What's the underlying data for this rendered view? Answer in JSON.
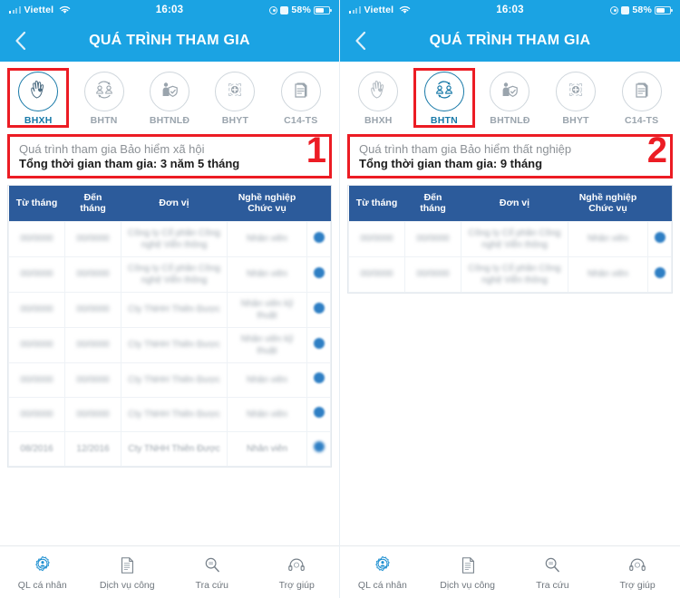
{
  "statusbar": {
    "carrier": "Viettel",
    "time": "16:03",
    "battery_pct": "58%",
    "wifi_icon": "wifi-icon",
    "location_icon": "location-icon",
    "alarm_icon": "alarm-icon",
    "battery_icon": "battery-icon",
    "signal_icon": "signal-bars-icon"
  },
  "header": {
    "title": "QUÁ TRÌNH THAM GIA",
    "back_icon": "chevron-left-icon",
    "bg_color": "#1ba3e3"
  },
  "tabs": [
    {
      "id": "bhxh",
      "label": "BHXH",
      "icon": "praying-hands-heart-icon"
    },
    {
      "id": "bhtn",
      "label": "BHTN",
      "icon": "people-exchange-icon"
    },
    {
      "id": "bhtnld",
      "label": "BHTNLĐ",
      "icon": "worker-shield-icon"
    },
    {
      "id": "bhyt",
      "label": "BHYT",
      "icon": "medical-cross-icon"
    },
    {
      "id": "c14ts",
      "label": "C14-TS",
      "icon": "document-list-icon"
    }
  ],
  "table": {
    "columns": [
      "Từ tháng",
      "Đến tháng",
      "Đơn vị",
      "Nghề nghiệp\nChức vụ",
      ""
    ],
    "col_from": "Từ tháng",
    "col_to_l1": "Đến",
    "col_to_l2": "tháng",
    "col_unit": "Đơn vị",
    "col_job_l1": "Nghề nghiệp",
    "col_job_l2": "Chức vụ",
    "header_bg": "#2c5b9b",
    "eye_icon": "eye-icon"
  },
  "panels": [
    {
      "step": "1",
      "active_tab": "bhxh",
      "info_title": "Quá trình tham gia Bảo hiểm xã hội",
      "info_total": "Tổng thời gian tham gia: 3 năm 5 tháng",
      "highlight_color": "#ec1c24",
      "rows": [
        {
          "from": "00/0000",
          "to": "00/0000",
          "unit": "Công ty Cổ phần Công nghệ Viễn thông",
          "job": "Nhân viên"
        },
        {
          "from": "00/0000",
          "to": "00/0000",
          "unit": "Công ty Cổ phần Công nghệ Viễn thông",
          "job": "Nhân viên"
        },
        {
          "from": "00/0000",
          "to": "00/0000",
          "unit": "Cty TNHH Thiên Được",
          "job": "Nhân viên kỹ thuật"
        },
        {
          "from": "00/0000",
          "to": "00/0000",
          "unit": "Cty TNHH Thiên Được",
          "job": "Nhân viên kỹ thuật"
        },
        {
          "from": "00/0000",
          "to": "00/0000",
          "unit": "Cty TNHH Thiên Được",
          "job": "Nhân viên"
        },
        {
          "from": "00/0000",
          "to": "00/0000",
          "unit": "Cty TNHH Thiên Được",
          "job": "Nhân viên"
        },
        {
          "from": "08/2016",
          "to": "12/2016",
          "unit": "Cty TNHH Thiên Được",
          "job": "Nhân viên",
          "sharp": true
        }
      ]
    },
    {
      "step": "2",
      "active_tab": "bhtn",
      "info_title": "Quá trình tham gia Bảo hiểm thất nghiệp",
      "info_total": "Tổng thời gian tham gia: 9 tháng",
      "highlight_color": "#ec1c24",
      "rows": [
        {
          "from": "00/0000",
          "to": "00/0000",
          "unit": "Công ty Cổ phần Công nghệ Viễn thông",
          "job": "Nhân viên"
        },
        {
          "from": "00/0000",
          "to": "00/0000",
          "unit": "Công ty Cổ phần Công nghệ Viễn thông",
          "job": "Nhân viên"
        }
      ]
    }
  ],
  "bottomnav": [
    {
      "id": "ql-ca-nhan",
      "label": "QL cá nhân",
      "icon": "user-gear-icon",
      "active": true
    },
    {
      "id": "dich-vu-cong",
      "label": "Dịch vụ công",
      "icon": "clipboard-icon",
      "active": false
    },
    {
      "id": "tra-cuu",
      "label": "Tra cứu",
      "icon": "magnifier-icon",
      "active": false
    },
    {
      "id": "tro-giup",
      "label": "Trợ giúp",
      "icon": "headset-icon",
      "active": false
    }
  ]
}
